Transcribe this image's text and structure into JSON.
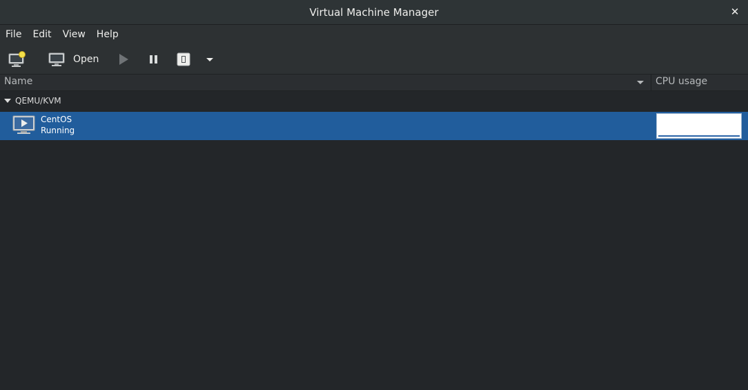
{
  "window": {
    "title": "Virtual Machine Manager",
    "close_icon": "close-icon"
  },
  "menu": {
    "items": [
      "File",
      "Edit",
      "View",
      "Help"
    ]
  },
  "toolbar": {
    "new_vm_icon": "new-vm-icon",
    "open_label": "Open",
    "open_icon": "monitor-icon",
    "run_icon": "play-icon",
    "pause_icon": "pause-icon",
    "shutdown_icon": "power-icon",
    "shutdown_menu_icon": "chevron-down-icon"
  },
  "columns": {
    "name": "Name",
    "cpu": "CPU usage"
  },
  "connections": [
    {
      "label": "QEMU/KVM",
      "vms": [
        {
          "name": "CentOS",
          "status": "Running",
          "icon": "running-vm-icon",
          "cpu_usage": 0
        }
      ]
    }
  ],
  "colors": {
    "selection": "#215d9c",
    "background": "#232629",
    "toolbar": "#2d3133"
  }
}
